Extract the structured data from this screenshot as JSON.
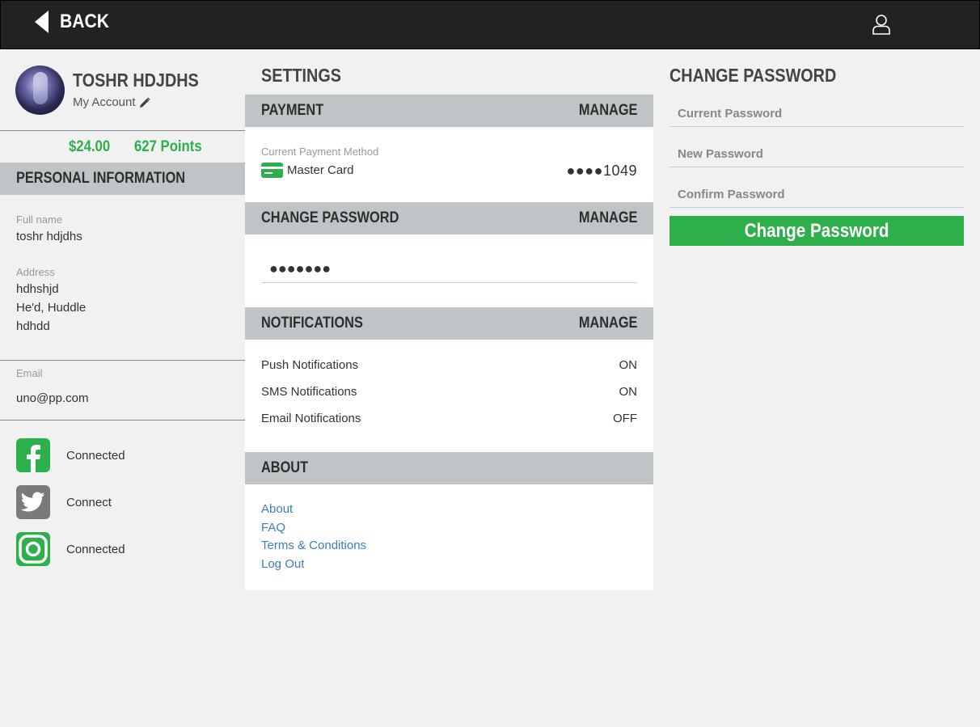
{
  "header": {
    "back_label": "BACK",
    "user_icon": "user-icon"
  },
  "profile": {
    "name": "TOSHR HDJDHS",
    "my_account": "My Account",
    "balance": "$24.00",
    "points": "627 Points"
  },
  "personal": {
    "title": "PERSONAL INFORMATION",
    "full_name_label": "Full name",
    "full_name": "toshr hdjdhs",
    "address_label": "Address",
    "address_lines": [
      "hdhshjd",
      "He'd, Huddle",
      "hdhdd"
    ],
    "email_label": "Email",
    "email": "uno@pp.com"
  },
  "social": [
    {
      "network": "facebook",
      "icon": "facebook-icon",
      "status": "Connected",
      "color": "#2db04b"
    },
    {
      "network": "twitter",
      "icon": "twitter-icon",
      "status": "Connect",
      "color": "#7a7a7a"
    },
    {
      "network": "instagram",
      "icon": "instagram-icon",
      "status": "Connected",
      "color": "#2db04b"
    }
  ],
  "settings": {
    "title": "SETTINGS",
    "manage_label": "MANAGE",
    "payment": {
      "title": "PAYMENT",
      "current_label": "Current Payment Method",
      "card_name": "Master Card",
      "card_number": "●●●●1049"
    },
    "change_password": {
      "title": "CHANGE PASSWORD",
      "masked": "●●●●●●●"
    },
    "notifications": {
      "title": "NOTIFICATIONS",
      "items": [
        {
          "label": "Push Notifications",
          "value": "ON"
        },
        {
          "label": "SMS Notifications",
          "value": "ON"
        },
        {
          "label": "Email Notifications",
          "value": "OFF"
        }
      ]
    },
    "about": {
      "title": "ABOUT",
      "links": [
        "About",
        "FAQ",
        "Terms & Conditions",
        "Log Out"
      ]
    }
  },
  "change_password_form": {
    "title": "CHANGE PASSWORD",
    "current_placeholder": "Current Password",
    "new_placeholder": "New Password",
    "confirm_placeholder": "Confirm Password",
    "button_label": "Change Password"
  },
  "colors": {
    "accent": "#2db04b",
    "header_bg": "#222222",
    "section_bg": "#bfc4c7",
    "link": "#3a7ebf"
  }
}
